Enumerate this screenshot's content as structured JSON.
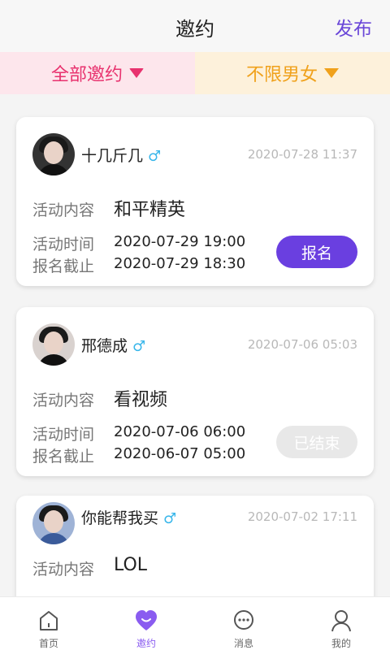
{
  "header": {
    "title": "邀约",
    "publish_label": "发布"
  },
  "filters": {
    "all_label": "全部邀约",
    "gender_label": "不限男女"
  },
  "labels": {
    "content": "活动内容",
    "time": "活动时间",
    "deadline": "报名截止"
  },
  "cards": [
    {
      "name": "十几斤几",
      "gender_icon": "male-icon",
      "posted": "2020-07-28 11:37",
      "content": "和平精英",
      "time": "2020-07-29 19:00",
      "deadline": "2020-07-29 18:30",
      "button": "报名"
    },
    {
      "name": "邢德成",
      "gender_icon": "male-icon",
      "posted": "2020-07-06 05:03",
      "content": "看视频",
      "time": "2020-07-06 06:00",
      "deadline": "2020-06-07 05:00",
      "button": "已结束"
    },
    {
      "name": "你能帮我买",
      "gender_icon": "male-icon",
      "posted": "2020-07-02 17:11",
      "content": "LOL",
      "time": "",
      "deadline": "",
      "button": ""
    }
  ],
  "tabs": [
    {
      "label": "首页",
      "icon": "home-icon"
    },
    {
      "label": "邀约",
      "icon": "heart-icon"
    },
    {
      "label": "消息",
      "icon": "message-icon"
    },
    {
      "label": "我的",
      "icon": "user-icon"
    }
  ],
  "colors": {
    "accent": "#6a3fe0",
    "pink": "#e8326e",
    "orange": "#f0a11b",
    "male": "#38b6ea"
  }
}
